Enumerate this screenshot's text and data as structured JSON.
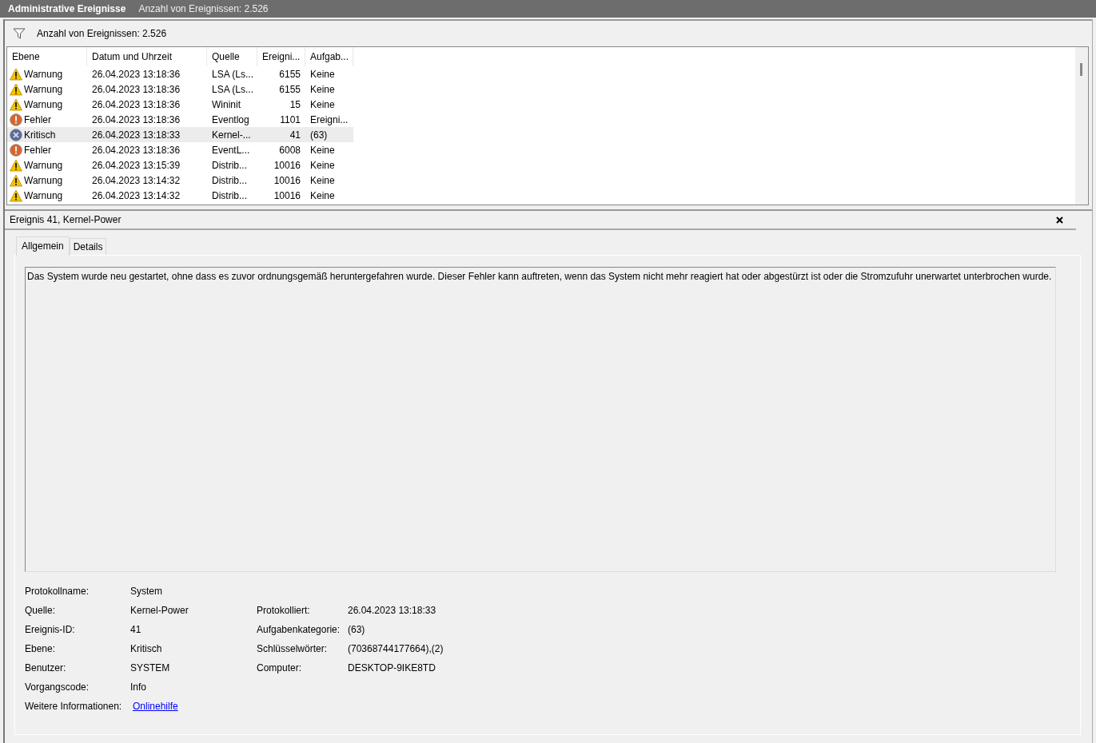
{
  "title_bar": {
    "title": "Administrative Ereignisse",
    "subtitle": "Anzahl von Ereignissen: 2.526"
  },
  "filter_bar": {
    "text": "Anzahl von Ereignissen: 2.526"
  },
  "table": {
    "columns": [
      "Ebene",
      "Datum und Uhrzeit",
      "Quelle",
      "Ereigni...",
      "Aufgab..."
    ],
    "rows": [
      {
        "kind": "warning",
        "level": "Warnung",
        "date": "26.04.2023 13:18:36",
        "source": "LSA (Ls...",
        "id": "6155",
        "task": "Keine",
        "selected": false
      },
      {
        "kind": "warning",
        "level": "Warnung",
        "date": "26.04.2023 13:18:36",
        "source": "LSA (Ls...",
        "id": "6155",
        "task": "Keine",
        "selected": false
      },
      {
        "kind": "warning",
        "level": "Warnung",
        "date": "26.04.2023 13:18:36",
        "source": "Wininit",
        "id": "15",
        "task": "Keine",
        "selected": false
      },
      {
        "kind": "error",
        "level": "Fehler",
        "date": "26.04.2023 13:18:36",
        "source": "Eventlog",
        "id": "1101",
        "task": "Ereigni...",
        "selected": false
      },
      {
        "kind": "critical",
        "level": "Kritisch",
        "date": "26.04.2023 13:18:33",
        "source": "Kernel-...",
        "id": "41",
        "task": "(63)",
        "selected": true
      },
      {
        "kind": "error",
        "level": "Fehler",
        "date": "26.04.2023 13:18:36",
        "source": "EventL...",
        "id": "6008",
        "task": "Keine",
        "selected": false
      },
      {
        "kind": "warning",
        "level": "Warnung",
        "date": "26.04.2023 13:15:39",
        "source": "Distrib...",
        "id": "10016",
        "task": "Keine",
        "selected": false
      },
      {
        "kind": "warning",
        "level": "Warnung",
        "date": "26.04.2023 13:14:32",
        "source": "Distrib...",
        "id": "10016",
        "task": "Keine",
        "selected": false
      },
      {
        "kind": "warning",
        "level": "Warnung",
        "date": "26.04.2023 13:14:32",
        "source": "Distrib...",
        "id": "10016",
        "task": "Keine",
        "selected": false
      }
    ]
  },
  "detail": {
    "title": "Ereignis 41, Kernel-Power",
    "tabs": [
      {
        "label": "Allgemein",
        "selected": true
      },
      {
        "label": "Details",
        "selected": false
      }
    ],
    "description": "Das System wurde neu gestartet, ohne dass es zuvor ordnungsgemäß heruntergefahren wurde. Dieser Fehler kann auftreten, wenn das System nicht mehr reagiert hat oder abgestürzt ist oder die Stromzufuhr unerwartet unterbrochen wurde.",
    "fields": [
      {
        "label": "Protokollname:",
        "value": "System"
      },
      {
        "label": "Quelle:",
        "value": "Kernel-Power",
        "right_label": "Protokolliert:",
        "right_value": "26.04.2023 13:18:33"
      },
      {
        "label": "Ereignis-ID:",
        "value": "41",
        "right_label": "Aufgabenkategorie:",
        "right_value": "(63)"
      },
      {
        "label": "Ebene:",
        "value": "Kritisch",
        "right_label": "Schlüsselwörter:",
        "right_value": "(70368744177664),(2)"
      },
      {
        "label": "Benutzer:",
        "value": "SYSTEM",
        "right_label": "Computer:",
        "right_value": "DESKTOP-9IKE8TD"
      },
      {
        "label": "Vorgangscode:",
        "value": "Info"
      },
      {
        "label": "Weitere Informationen:",
        "value": "Onlinehilfe",
        "kind": "link"
      }
    ]
  }
}
